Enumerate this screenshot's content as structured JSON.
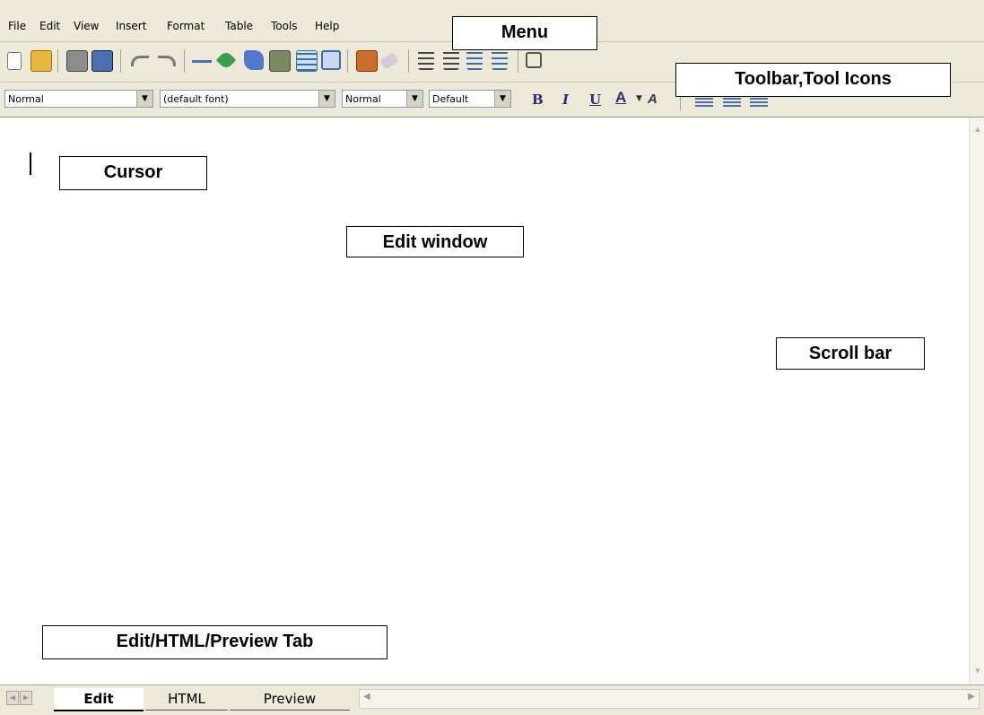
{
  "menu": {
    "items": [
      "File",
      "Edit",
      "View",
      "Insert",
      "Format",
      "Table",
      "Tools",
      "Help"
    ]
  },
  "toolbar": {
    "icons": [
      "new-document-icon",
      "open-folder-icon",
      "print-icon",
      "preview-monitor-icon",
      "undo-icon",
      "redo-icon",
      "horizontal-rule-icon",
      "link-icon",
      "bookmark-icon",
      "image-icon",
      "table-icon",
      "form-icon",
      "spellcheck-icon",
      "eraser-icon",
      "numbered-list-icon",
      "bullet-list-icon",
      "outdent-icon",
      "indent-icon",
      "grid-icon"
    ]
  },
  "formatting": {
    "paragraph_style": "Normal",
    "font_name": "(default font)",
    "font_size": "Normal",
    "font_color": "Default",
    "bold": "B",
    "italic": "I",
    "underline": "U",
    "text_color": "A",
    "highlight": "A"
  },
  "callouts": {
    "menu": "Menu",
    "toolbar": "Toolbar,Tool Icons",
    "cursor": "Cursor",
    "edit_window": "Edit window",
    "scroll_bar": "Scroll bar",
    "tabs": "Edit/HTML/Preview Tab"
  },
  "tabs": [
    {
      "label": "Edit",
      "active": true
    },
    {
      "label": "HTML",
      "active": false
    },
    {
      "label": "Preview",
      "active": false
    }
  ],
  "colors": {
    "chrome": "#ece9d8",
    "icon_blue": "#3a6ea5",
    "format_blue": "#2c2c7a"
  }
}
